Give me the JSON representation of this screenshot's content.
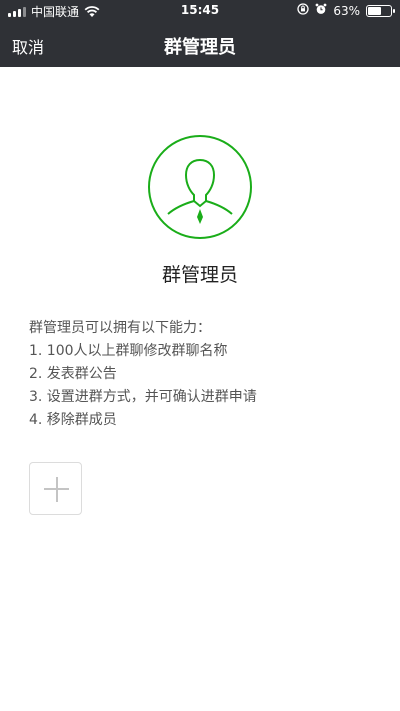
{
  "status_bar": {
    "carrier": "中国联通",
    "time": "15:45",
    "battery_percent": "63%",
    "battery_level": 0.63
  },
  "nav": {
    "cancel_label": "取消",
    "title": "群管理员"
  },
  "main": {
    "role_name": "群管理员",
    "abilities_heading": "群管理员可以拥有以下能力：",
    "abilities": [
      "1. 100人以上群聊修改群聊名称",
      "2. 发表群公告",
      "3. 设置进群方式，并可确认进群申请",
      "4. 移除群成员"
    ]
  },
  "colors": {
    "nav_bg": "#2f3136",
    "accent_green": "#1aad19"
  },
  "icons": {
    "avatar": "admin-avatar-icon",
    "add": "plus-icon"
  }
}
